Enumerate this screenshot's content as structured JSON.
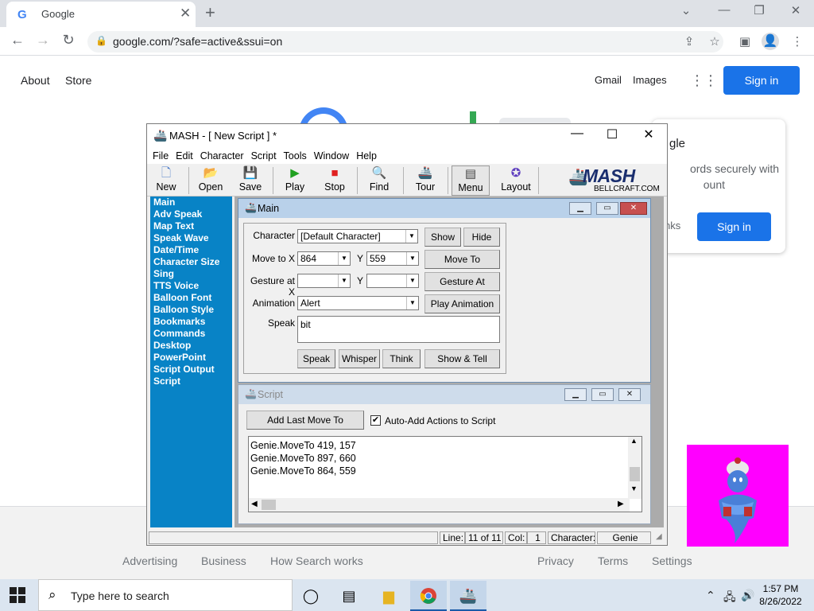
{
  "browser": {
    "tab_title": "Google",
    "tab_favicon": "G",
    "url": "google.com/?safe=active&ssui=on"
  },
  "google": {
    "top_left": [
      "About",
      "Store"
    ],
    "gmail": "Gmail",
    "images": "Images",
    "signin": "Sign in",
    "popup_title": "gle",
    "popup_text": "ords securely with",
    "popup_text2": "ount",
    "popup_links": "nks",
    "popup_signin": "Sign in",
    "footer_left": [
      "Advertising",
      "Business",
      "How Search works"
    ],
    "footer_right": [
      "Privacy",
      "Terms",
      "Settings"
    ]
  },
  "mash": {
    "title": "MASH - [ New Script ] *",
    "menu": [
      "File",
      "Edit",
      "Character",
      "Script",
      "Tools",
      "Window",
      "Help"
    ],
    "toolbar": [
      "New",
      "Open",
      "Save",
      "Play",
      "Stop",
      "Find",
      "Tour",
      "Menu",
      "Layout"
    ],
    "logo": "MASH",
    "logo_sub": "BELLCRAFT.COM",
    "sidebar": [
      "Main",
      "Adv Speak",
      "Map Text",
      "Speak Wave",
      "Date/Time",
      "Character Size",
      "Sing",
      "TTS Voice",
      "Balloon Font",
      "Balloon Style",
      "Bookmarks",
      "Commands",
      "Desktop",
      "PowerPoint",
      "Script Output",
      "Script"
    ],
    "main": {
      "title": "Main",
      "character_label": "Character",
      "character_value": "[Default Character]",
      "show": "Show",
      "hide": "Hide",
      "moveto_label": "Move to X",
      "moveto_x": "864",
      "y_label": "Y",
      "moveto_y": "559",
      "moveto_btn": "Move To",
      "gesture_label": "Gesture at X",
      "gesture_x": "",
      "gesture_y": "",
      "gesture_btn": "Gesture At",
      "animation_label": "Animation",
      "animation_value": "Alert",
      "play_animation": "Play Animation",
      "speak_label": "Speak",
      "speak_text": "bit",
      "speak_btn": "Speak",
      "whisper_btn": "Whisper",
      "think_btn": "Think",
      "showtell_btn": "Show & Tell"
    },
    "script": {
      "title": "Script",
      "add_last_move": "Add Last Move To",
      "auto_add": "Auto-Add Actions to Script",
      "auto_add_checked": true,
      "lines": [
        "Genie.MoveTo 419, 157",
        "Genie.MoveTo 897, 660",
        "Genie.MoveTo 864, 559"
      ]
    },
    "status": {
      "line_label": "Line:",
      "line_value": "11 of 11",
      "col_label": "Col:",
      "col_value": "1",
      "char_label": "Character:",
      "char_value": "Genie"
    }
  },
  "taskbar": {
    "search_placeholder": "Type here to search",
    "time": "1:57 PM",
    "date": "8/26/2022"
  },
  "colors": {
    "sidebar": "#0883c6",
    "google_blue": "#1a73e8",
    "genie_bg": "#ff00ff"
  }
}
